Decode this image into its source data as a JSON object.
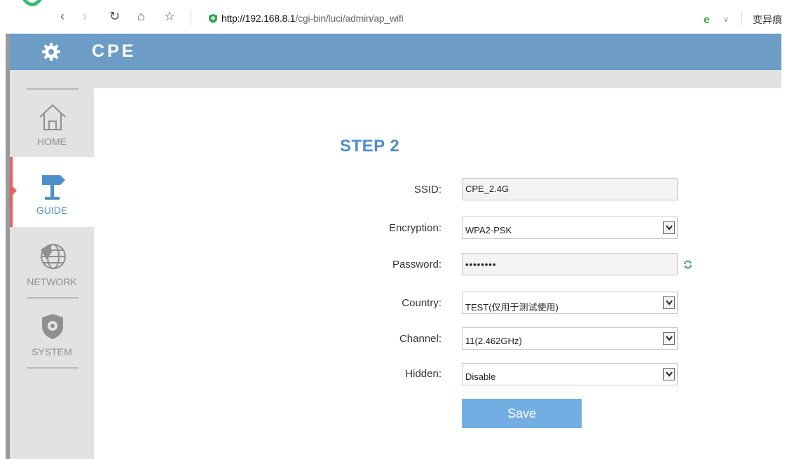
{
  "browser": {
    "url_host": "http://192.168.8.1",
    "url_path": "/cgi-bin/luci/admin/ap_wifi",
    "user_label": "变异痕"
  },
  "header": {
    "title": "CPE"
  },
  "sidebar": {
    "items": [
      {
        "label": "HOME",
        "icon": "home-icon",
        "active": false
      },
      {
        "label": "GUIDE",
        "icon": "signpost-icon",
        "active": true
      },
      {
        "label": "NETWORK",
        "icon": "globe-icon",
        "active": false
      },
      {
        "label": "SYSTEM",
        "icon": "shield-gear-icon",
        "active": false
      }
    ]
  },
  "main": {
    "step_title": "STEP 2",
    "fields": {
      "ssid": {
        "label": "SSID:",
        "value": "CPE_2.4G"
      },
      "encryption": {
        "label": "Encryption:",
        "value": "WPA2-PSK"
      },
      "password": {
        "label": "Password:",
        "value": "••••••••"
      },
      "country": {
        "label": "Country:",
        "value": "TEST(仅用于测试使用)"
      },
      "channel": {
        "label": "Channel:",
        "value": "11(2.462GHz)"
      },
      "hidden": {
        "label": "Hidden:",
        "value": "Disable"
      }
    },
    "save_label": "Save"
  },
  "colors": {
    "header_bg": "#6d9dc6",
    "accent_blue": "#4e8ecc",
    "active_marker": "#e8615b",
    "save_button": "#73aee2"
  }
}
